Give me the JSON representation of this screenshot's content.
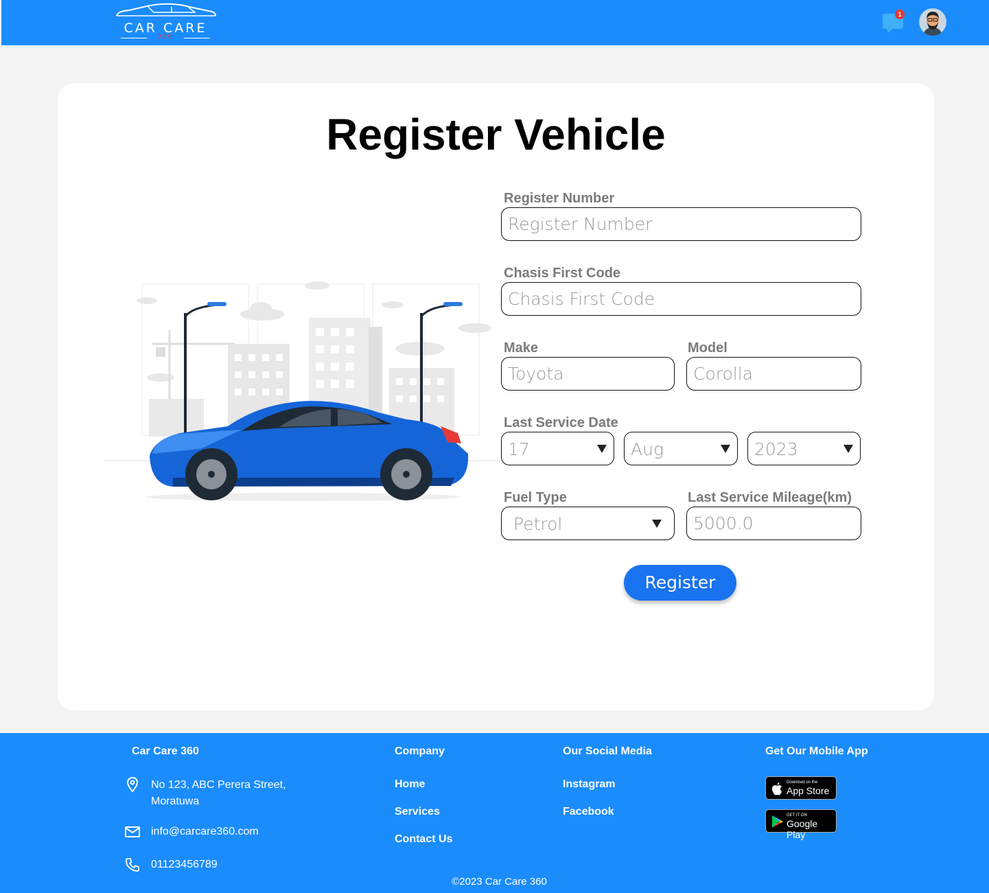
{
  "header": {
    "logo_text": "CAR CARE",
    "logo_sub": "360",
    "message_count": "1"
  },
  "main": {
    "title": "Register Vehicle",
    "fields": {
      "register_number": {
        "label": "Register Number",
        "placeholder": "Register Number"
      },
      "chasis": {
        "label": "Chasis First Code",
        "placeholder": "Chasis First Code"
      },
      "make": {
        "label": "Make",
        "placeholder": "Toyota"
      },
      "model": {
        "label": "Model",
        "placeholder": "Corolla"
      },
      "last_service_date": {
        "label": "Last Service Date",
        "day": "17",
        "month": "Aug",
        "year": "2023"
      },
      "fuel_type": {
        "label": "Fuel Type",
        "value": "Petrol"
      },
      "mileage": {
        "label": "Last Service Mileage(km)",
        "placeholder": "5000.0"
      }
    },
    "register_label": "Register"
  },
  "footer": {
    "brand": {
      "heading": "Car Care 360",
      "address_line1": "No 123, ABC Perera Street,",
      "address_line2": "Moratuwa",
      "email": "info@carcare360.com",
      "phone": "01123456789"
    },
    "company": {
      "heading": "Company",
      "links": [
        "Home",
        "Services",
        "Contact Us"
      ]
    },
    "social": {
      "heading": "Our Social Media",
      "links": [
        "Instagram",
        "Facebook"
      ]
    },
    "app": {
      "heading": "Get Our Mobile App",
      "appstore_small": "Download on the",
      "appstore_big": "App Store",
      "googleplay_small": "GET IT ON",
      "googleplay_big": "Google Play"
    },
    "copyright": "©2023 Car Care 360"
  },
  "colors": {
    "primary": "#1b8cfc",
    "button": "#1a73f0",
    "badge": "#e53935",
    "background": "#f4f3f4"
  }
}
